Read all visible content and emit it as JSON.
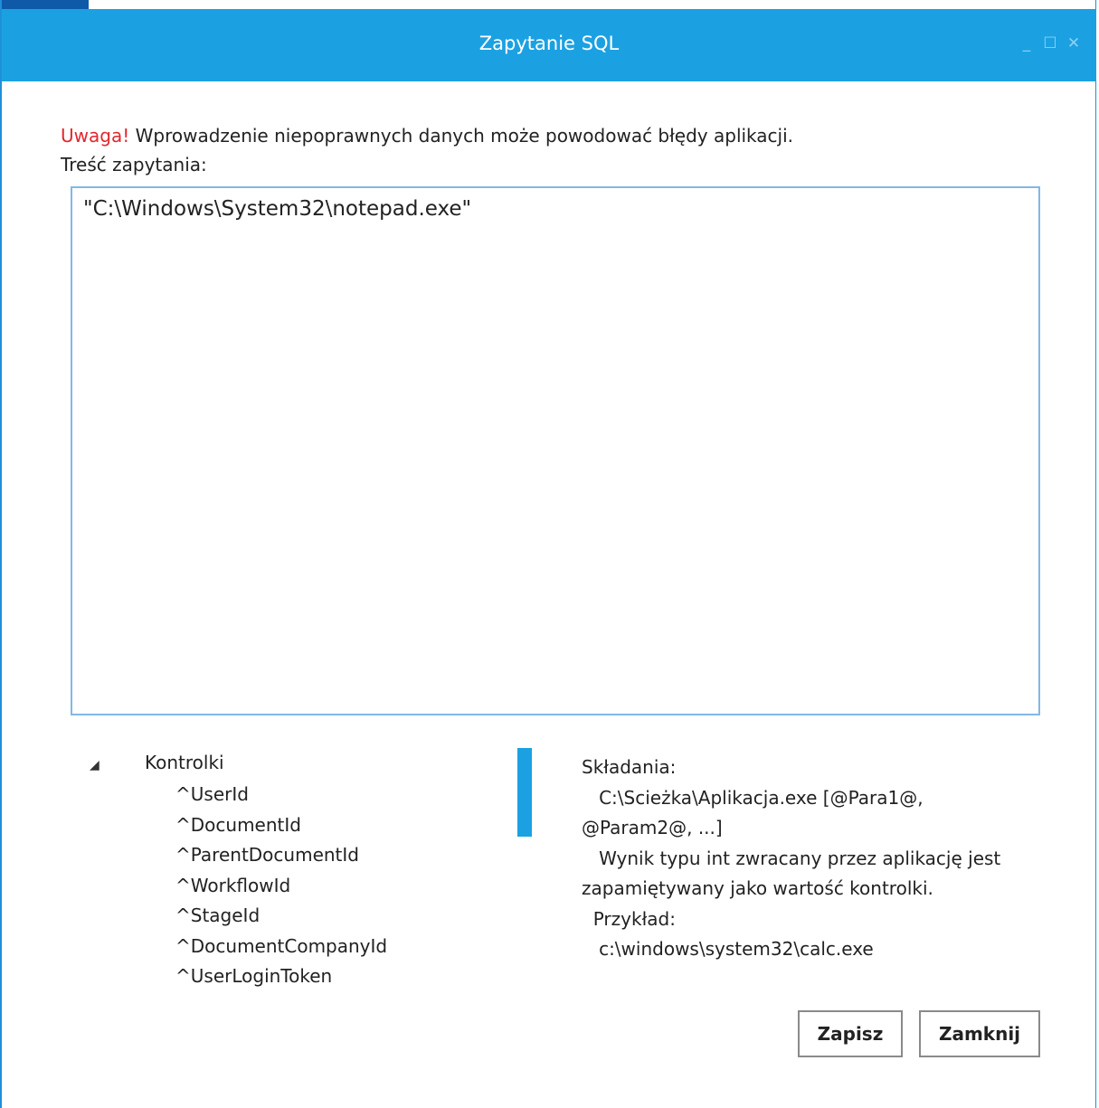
{
  "window": {
    "title": "Zapytanie SQL",
    "minimize_glyph": "_",
    "maximize_glyph": "☐",
    "close_glyph": "✕"
  },
  "warning": {
    "lead": "Uwaga!",
    "text": " Wprowadzenie niepoprawnych danych może powodować błędy aplikacji."
  },
  "query": {
    "label": "Treść zapytania:",
    "value": "\"C:\\Windows\\System32\\notepad.exe\""
  },
  "tree": {
    "toggle_glyph": "◢",
    "root_label": "Kontrolki",
    "items": [
      "^UserId",
      "^DocumentId",
      "^ParentDocumentId",
      "^WorkflowId",
      "^StageId",
      "^DocumentCompanyId",
      "^UserLoginToken"
    ]
  },
  "help": {
    "lines": [
      "Składania:",
      "   C:\\Scieżka\\Aplikacja.exe [@Para1@,",
      "@Param2@, ...]",
      "   Wynik typu int zwracany przez aplikację jest",
      "zapamiętywany jako wartość kontrolki.",
      "  Przykład:",
      "   c:\\windows\\system32\\calc.exe"
    ]
  },
  "buttons": {
    "save_label": "Zapisz",
    "close_label": "Zamknij"
  },
  "colors": {
    "titlebar": "#1ba1e2",
    "warning": "#e3262e",
    "query_border": "#82b8e5"
  }
}
